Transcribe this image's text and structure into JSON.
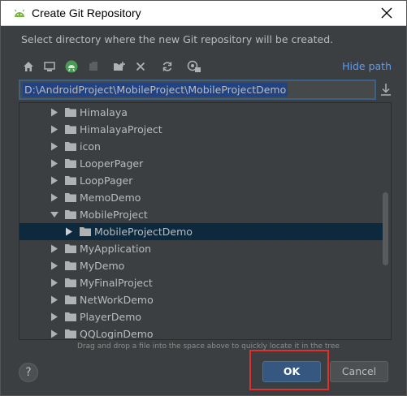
{
  "dialog": {
    "title": "Create Git Repository",
    "description": "Select directory where the new Git repository will be created.",
    "hide_path_label": "Hide path",
    "path_value": "D:\\AndroidProject\\MobileProject\\MobileProjectDemo",
    "hint": "Drag and drop a file into the space above to quickly locate it in the tree",
    "ok_label": "OK",
    "cancel_label": "Cancel",
    "help_label": "?"
  },
  "toolbar_icons": [
    "home-icon",
    "desktop-icon",
    "android-project-icon",
    "module-icon",
    "new-folder-icon",
    "delete-icon",
    "refresh-icon",
    "show-hidden-icon"
  ],
  "tree": {
    "items": [
      {
        "label": "Himalaya",
        "expanded": false,
        "selected": false
      },
      {
        "label": "HimalayaProject",
        "expanded": false,
        "selected": false
      },
      {
        "label": "icon",
        "expanded": false,
        "selected": false
      },
      {
        "label": "LooperPager",
        "expanded": false,
        "selected": false
      },
      {
        "label": "LoopPager",
        "expanded": false,
        "selected": false
      },
      {
        "label": "MemoDemo",
        "expanded": false,
        "selected": false
      },
      {
        "label": "MobileProject",
        "expanded": true,
        "selected": false
      },
      {
        "label": "MobileProjectDemo",
        "expanded": false,
        "selected": true
      },
      {
        "label": "MyApplication",
        "expanded": false,
        "selected": false
      },
      {
        "label": "MyDemo",
        "expanded": false,
        "selected": false
      },
      {
        "label": "MyFinalProject",
        "expanded": false,
        "selected": false
      },
      {
        "label": "NetWorkDemo",
        "expanded": false,
        "selected": false
      },
      {
        "label": "PlayerDemo",
        "expanded": false,
        "selected": false
      },
      {
        "label": "QQLoginDemo",
        "expanded": false,
        "selected": false
      }
    ]
  },
  "colors": {
    "dialog_bg": "#3c3f41",
    "selection": "#0d293e",
    "path_selection": "#214283",
    "link": "#589df6",
    "ok_button": "#365880",
    "highlight_box": "#e0302e"
  }
}
